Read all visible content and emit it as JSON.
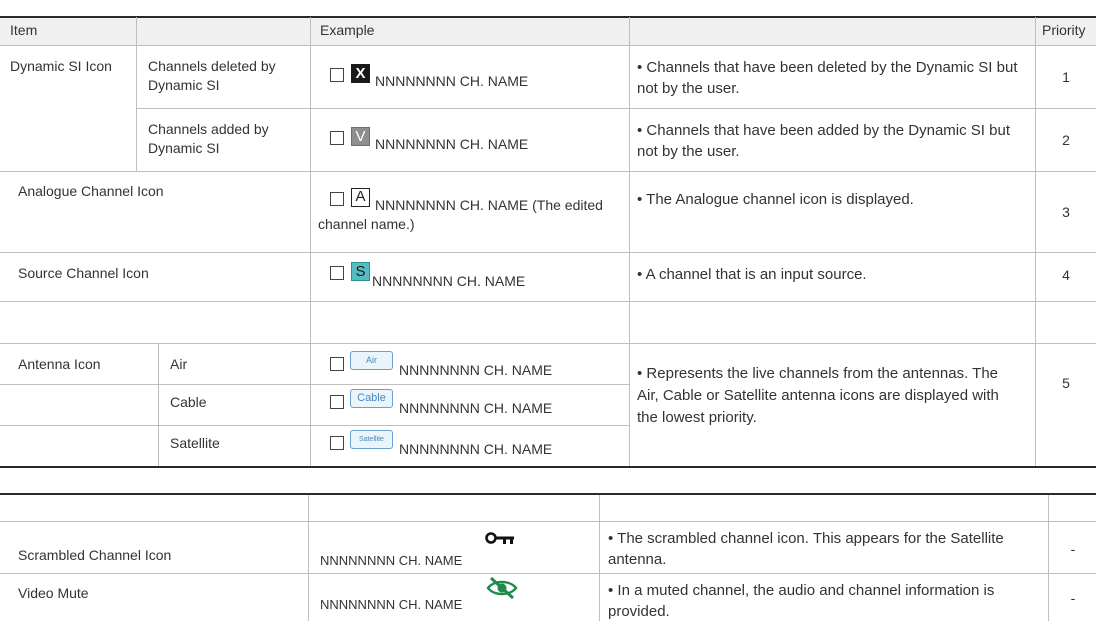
{
  "header": {
    "item": "Item",
    "example": "Example",
    "priority": "Priority"
  },
  "rows": {
    "dynamic_si": {
      "label": "Dynamic SI Icon",
      "deleted": {
        "sub": "Channels deleted by Dynamic SI",
        "icon": "X",
        "example": "NNNNNNNN CH. NAME",
        "desc": "Channels that have been deleted by the Dynamic SI but not by the user.",
        "priority": "1"
      },
      "added": {
        "sub": "Channels added by Dynamic SI",
        "icon": "V",
        "example": "NNNNNNNN CH. NAME",
        "desc": "Channels that have been added by the Dynamic SI but not by the user.",
        "priority": "2"
      }
    },
    "analogue": {
      "label": "Analogue Channel Icon",
      "icon": "A",
      "example": "NNNNNNNN CH. NAME (The edited channel name.)",
      "desc": "The Analogue channel icon is displayed.",
      "priority": "3"
    },
    "source": {
      "label": "Source Channel Icon",
      "icon": "S",
      "example": "NNNNNNNN CH. NAME",
      "desc": "A channel that is an input source.",
      "priority": "4"
    },
    "antenna": {
      "label": "Antenna Icon",
      "air": {
        "sub": "Air",
        "icon": "Air",
        "example": "NNNNNNNN CH. NAME"
      },
      "cable": {
        "sub": "Cable",
        "icon": "Cable",
        "example": "NNNNNNNN CH. NAME"
      },
      "satellite": {
        "sub": "Satellite",
        "icon": "Satellite",
        "example": "NNNNNNNN CH. NAME"
      },
      "desc": "Represents the live channels from the antennas. The Air, Cable or Satellite antenna icons are displayed with the lowest priority.",
      "priority": "5"
    }
  },
  "table2": {
    "scrambled": {
      "label": "Scrambled Channel Icon",
      "example": "NNNNNNNN CH. NAME",
      "icon": "key-icon",
      "desc": "The scrambled channel icon. This appears for the Satellite antenna.",
      "priority": "-"
    },
    "video_mute": {
      "label": "Video Mute",
      "example": "NNNNNNNN CH. NAME",
      "icon": "eye-slash-icon",
      "desc": "In a muted channel, the audio and channel information is provided.",
      "priority": "-"
    }
  },
  "colors": {
    "header_bg": "#f0f0f0",
    "source_icon": "#56bcc2",
    "antenna_icon": "#6b9fd4",
    "mute_icon": "#1f8a4c"
  }
}
